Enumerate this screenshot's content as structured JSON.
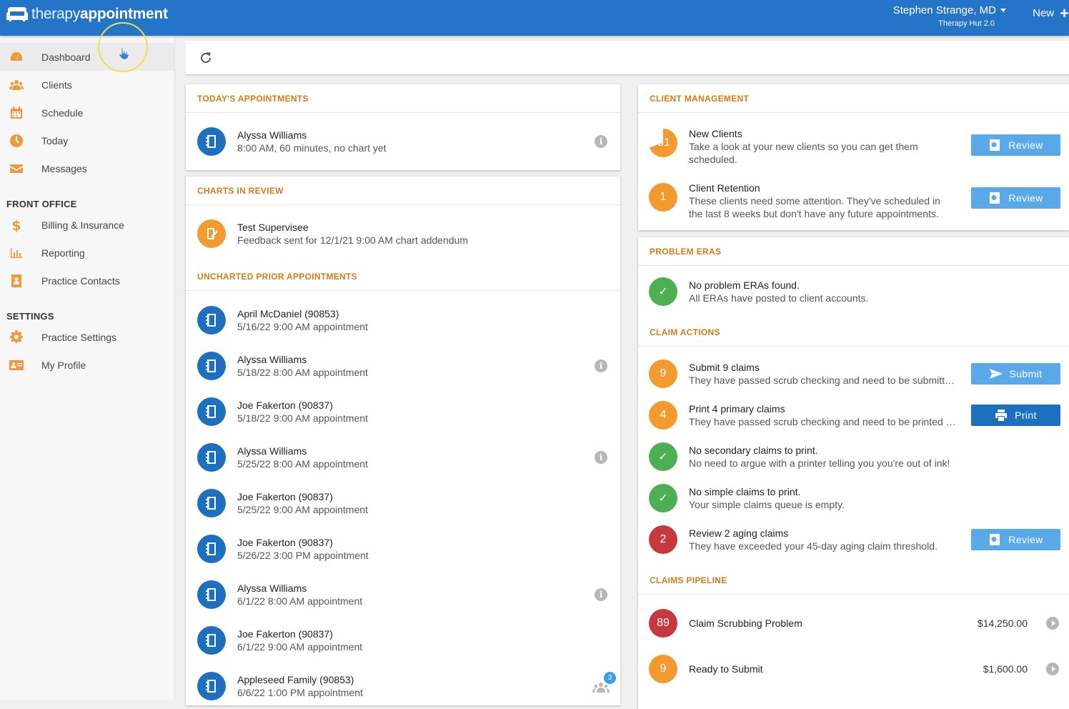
{
  "header": {
    "logo_light": "therapy",
    "logo_bold": "appointment",
    "user_name": "Stephen Strange, MD",
    "practice": "Therapy Hut 2.0",
    "new_label": "New"
  },
  "sidebar": {
    "items": [
      {
        "label": "Dashboard",
        "icon": "dashboard-icon"
      },
      {
        "label": "Clients",
        "icon": "users-icon"
      },
      {
        "label": "Schedule",
        "icon": "calendar-icon"
      },
      {
        "label": "Today",
        "icon": "clock-icon"
      },
      {
        "label": "Messages",
        "icon": "envelope-icon"
      }
    ],
    "front_office_title": "FRONT OFFICE",
    "front_office": [
      {
        "label": "Billing & Insurance",
        "icon": "dollar-icon"
      },
      {
        "label": "Reporting",
        "icon": "bar-chart-icon"
      },
      {
        "label": "Practice Contacts",
        "icon": "contact-book-icon"
      }
    ],
    "settings_title": "SETTINGS",
    "settings": [
      {
        "label": "Practice Settings",
        "icon": "gear-icon"
      },
      {
        "label": "My Profile",
        "icon": "id-card-icon"
      }
    ]
  },
  "todays_appointments": {
    "title": "TODAY'S APPOINTMENTS",
    "items": [
      {
        "name": "Alyssa Williams",
        "detail": "8:00 AM, 60 minutes, no chart yet"
      }
    ]
  },
  "charts_in_review": {
    "title": "CHARTS IN REVIEW",
    "items": [
      {
        "name": "Test Supervisee",
        "detail": "Feedback sent for 12/1/21 9:00 AM chart addendum"
      }
    ]
  },
  "uncharted": {
    "title": "UNCHARTED PRIOR APPOINTMENTS",
    "items": [
      {
        "name": "April McDaniel (90853)",
        "detail": "5/16/22 9:00 AM appointment"
      },
      {
        "name": "Alyssa Williams",
        "detail": "5/18/22 8:00 AM appointment"
      },
      {
        "name": "Joe Fakerton (90837)",
        "detail": "5/18/22 9:00 AM appointment"
      },
      {
        "name": "Alyssa Williams",
        "detail": "5/25/22 8:00 AM appointment"
      },
      {
        "name": "Joe Fakerton (90837)",
        "detail": "5/25/22 9:00 AM appointment"
      },
      {
        "name": "Joe Fakerton (90837)",
        "detail": "5/26/22 3:00 PM appointment"
      },
      {
        "name": "Alyssa Williams",
        "detail": "6/1/22 8:00 AM appointment"
      },
      {
        "name": "Joe Fakerton (90837)",
        "detail": "6/1/22 9:00 AM appointment"
      },
      {
        "name": "Appleseed Family (90853)",
        "detail": "6/6/22 1:00 PM appointment",
        "group_count": "3"
      }
    ]
  },
  "client_management": {
    "title": "CLIENT MANAGEMENT",
    "items": [
      {
        "count": "81",
        "title": "New Clients",
        "detail_1": "Take a look at your new clients so you can get them",
        "detail_2": "scheduled.",
        "button": "Review"
      },
      {
        "count": "1",
        "title": "Client Retention",
        "detail_1": "These clients need some attention. They've scheduled in",
        "detail_2": "the last 8 weeks but don't have any future appointments.",
        "button": "Review"
      }
    ]
  },
  "problem_eras": {
    "title": "PROBLEM ERAS",
    "item": {
      "title": "No problem ERAs found.",
      "detail": "All ERAs have posted to client accounts."
    }
  },
  "claim_actions": {
    "title": "CLAIM ACTIONS",
    "items": [
      {
        "count": "9",
        "title": "Submit 9 claims",
        "detail": "They have passed scrub checking and need to be submitt…",
        "button": "Submit"
      },
      {
        "count": "4",
        "title": "Print 4 primary claims",
        "detail": "They have passed scrub checking and need to be printed …",
        "button": "Print"
      },
      {
        "title": "No secondary claims to print.",
        "detail": "No need to argue with a printer telling you you're out of ink!"
      },
      {
        "title": "No simple claims to print.",
        "detail": "Your simple claims queue is empty."
      },
      {
        "count": "2",
        "title": "Review 2 aging claims",
        "detail": "They have exceeded your 45-day aging claim threshold.",
        "button": "Review"
      }
    ]
  },
  "claims_pipeline": {
    "title": "CLAIMS PIPELINE",
    "items": [
      {
        "count": "89",
        "label": "Claim Scrubbing Problem",
        "amount": "$14,250.00"
      },
      {
        "count": "9",
        "label": "Ready to Submit",
        "amount": "$1,600.00"
      }
    ]
  },
  "colors": {
    "brand_blue": "#2474c8",
    "accent_orange": "#ef9a3a",
    "success_green": "#4cb053",
    "danger_red": "#c4383e"
  }
}
